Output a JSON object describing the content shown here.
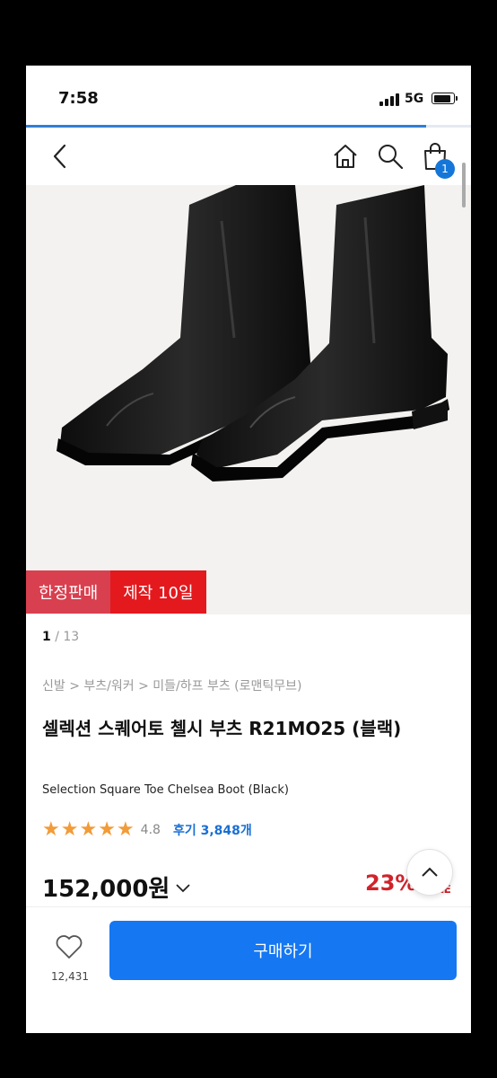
{
  "status_bar": {
    "time": "7:58",
    "network": "5G",
    "page_load_progress_percent": 90
  },
  "header": {
    "cart_count": "1"
  },
  "product": {
    "image_label": "Black square toe chelsea boots",
    "badges": [
      "한정판매",
      "제작 10일"
    ],
    "image_index": "1",
    "image_total": "/ 13",
    "breadcrumb": "신발 > 부츠/워커 > 미들/하프 부츠 (로맨틱무브)",
    "title": "셀렉션 스퀘어토 첼시 부츠 R21MO25 (블랙)",
    "subtitle": "Selection Square Toe Chelsea Boot (Black)",
    "rating_stars": 4.8,
    "rating": "4.8",
    "reviews": "후기 3,848개",
    "price": "152,000원",
    "discount": "23%",
    "sale_tag": "LE"
  },
  "bottom_bar": {
    "like_count": "12,431",
    "buy_label": "구매하기"
  },
  "colors": {
    "accent": "#1577f2",
    "badge_limited": "#d8404f",
    "badge_days": "#e3191e",
    "star": "#f29b38",
    "discount": "#d0232b",
    "review_link": "#1a6fd3"
  },
  "icons": [
    "back-arrow-icon",
    "home-icon",
    "search-icon",
    "shopping-bag-icon",
    "chevron-down-icon",
    "chevron-up-icon",
    "heart-icon"
  ]
}
